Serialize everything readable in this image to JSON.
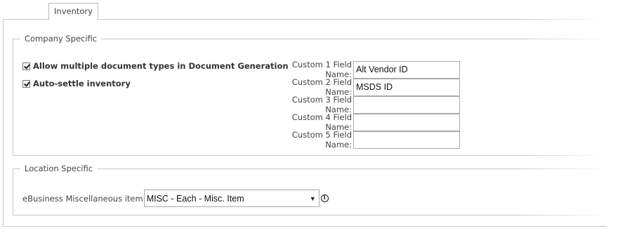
{
  "tabs": [
    {
      "label": "Inventory",
      "active": true
    }
  ],
  "company": {
    "legend": "Company Specific",
    "checkboxes": [
      {
        "label": "Allow multiple document types in Document Generation",
        "checked": true
      },
      {
        "label": "Auto-settle inventory",
        "checked": true
      }
    ],
    "custom_fields": [
      {
        "label": "Custom 1 Field Name:",
        "value": "Alt Vendor ID"
      },
      {
        "label": "Custom 2 Field Name:",
        "value": "MSDS ID"
      },
      {
        "label": "Custom 3 Field Name:",
        "value": ""
      },
      {
        "label": "Custom 4 Field Name:",
        "value": ""
      },
      {
        "label": "Custom 5 Field Name:",
        "value": ""
      }
    ]
  },
  "location": {
    "legend": "Location Specific",
    "misc_item_label": "eBusiness Miscellaneous item",
    "misc_item_selected": "MISC - Each - Misc. Item",
    "info_icon": "info-icon"
  }
}
